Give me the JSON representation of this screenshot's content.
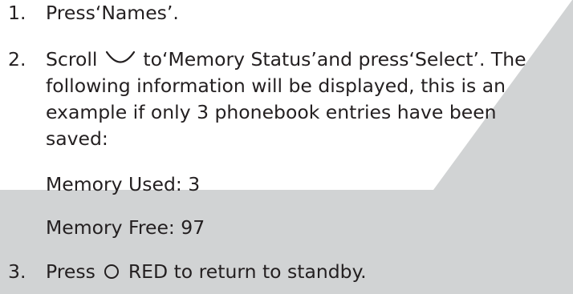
{
  "colors": {
    "text": "#231f20",
    "shade": "#d1d3d4",
    "background": "#ffffff"
  },
  "steps": [
    {
      "number": "1.",
      "text": "Press‘Names’."
    },
    {
      "number": "2.",
      "line1_before_icon": "Scroll",
      "icon": "scroll-down-icon",
      "line1_after_icon": "to‘Memory Status’and press‘Select’. The",
      "line2": "following information will be displayed, this is an",
      "line3": "example if only 3 phonebook entries have been",
      "line4": "saved:",
      "memory_used": "Memory Used: 3",
      "memory_free": "Memory Free: 97"
    },
    {
      "number": "3.",
      "text_before_icon": "Press",
      "icon": "red-button-icon",
      "text_after_icon": "RED to return to standby."
    }
  ]
}
